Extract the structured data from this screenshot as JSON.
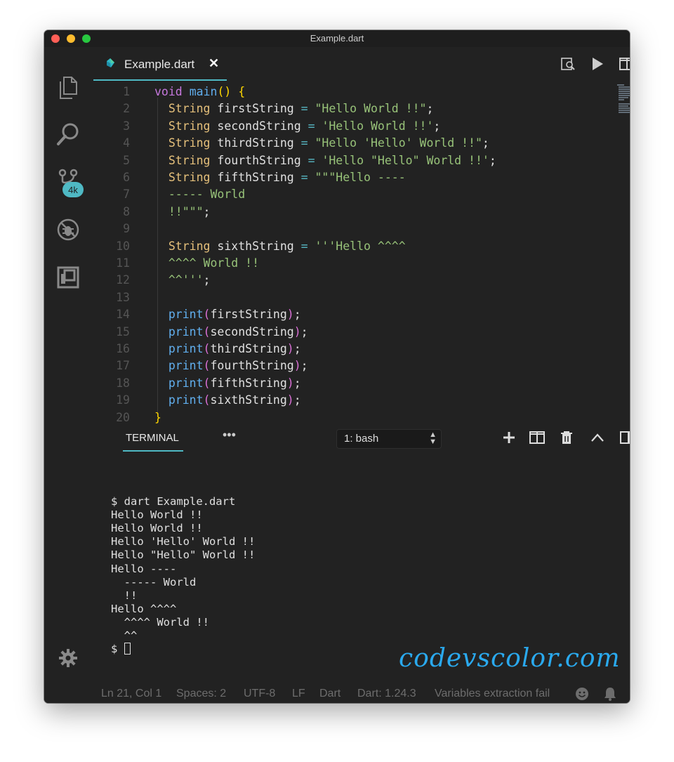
{
  "window": {
    "title": "Example.dart"
  },
  "activity_bar": {
    "scm_badge": "4k"
  },
  "tab": {
    "label": "Example.dart",
    "close_glyph": "✕"
  },
  "code": [
    {
      "n": "1",
      "tokens": [
        {
          "t": "void",
          "c": "kw"
        },
        {
          "t": " "
        },
        {
          "t": "main",
          "c": "fn"
        },
        {
          "t": "()",
          "c": "pa1"
        },
        {
          "t": " "
        },
        {
          "t": "{",
          "c": "pa1"
        }
      ]
    },
    {
      "n": "2",
      "tokens": [
        {
          "t": "  "
        },
        {
          "t": "String",
          "c": "ty"
        },
        {
          "t": " firstString "
        },
        {
          "t": "=",
          "c": "op"
        },
        {
          "t": " "
        },
        {
          "t": "\"Hello World !!\"",
          "c": "str"
        },
        {
          "t": ";"
        }
      ]
    },
    {
      "n": "3",
      "tokens": [
        {
          "t": "  "
        },
        {
          "t": "String",
          "c": "ty"
        },
        {
          "t": " secondString "
        },
        {
          "t": "=",
          "c": "op"
        },
        {
          "t": " "
        },
        {
          "t": "'Hello World !!'",
          "c": "str"
        },
        {
          "t": ";"
        }
      ]
    },
    {
      "n": "4",
      "tokens": [
        {
          "t": "  "
        },
        {
          "t": "String",
          "c": "ty"
        },
        {
          "t": " thirdString "
        },
        {
          "t": "=",
          "c": "op"
        },
        {
          "t": " "
        },
        {
          "t": "\"Hello 'Hello' World !!\"",
          "c": "str"
        },
        {
          "t": ";"
        }
      ]
    },
    {
      "n": "5",
      "tokens": [
        {
          "t": "  "
        },
        {
          "t": "String",
          "c": "ty"
        },
        {
          "t": " fourthString "
        },
        {
          "t": "=",
          "c": "op"
        },
        {
          "t": " "
        },
        {
          "t": "'Hello \"Hello\" World !!'",
          "c": "str"
        },
        {
          "t": ";"
        }
      ]
    },
    {
      "n": "6",
      "tokens": [
        {
          "t": "  "
        },
        {
          "t": "String",
          "c": "ty"
        },
        {
          "t": " fifthString "
        },
        {
          "t": "=",
          "c": "op"
        },
        {
          "t": " "
        },
        {
          "t": "\"\"\"Hello ----",
          "c": "str"
        }
      ]
    },
    {
      "n": "7",
      "tokens": [
        {
          "t": "  "
        },
        {
          "t": "----- World",
          "c": "str"
        }
      ]
    },
    {
      "n": "8",
      "tokens": [
        {
          "t": "  "
        },
        {
          "t": "!!\"\"\"",
          "c": "str"
        },
        {
          "t": ";"
        }
      ]
    },
    {
      "n": "9",
      "tokens": []
    },
    {
      "n": "10",
      "tokens": [
        {
          "t": "  "
        },
        {
          "t": "String",
          "c": "ty"
        },
        {
          "t": " sixthString "
        },
        {
          "t": "=",
          "c": "op"
        },
        {
          "t": " "
        },
        {
          "t": "'''Hello ^^^^",
          "c": "str"
        }
      ]
    },
    {
      "n": "11",
      "tokens": [
        {
          "t": "  "
        },
        {
          "t": "^^^^ World !!",
          "c": "str"
        }
      ]
    },
    {
      "n": "12",
      "tokens": [
        {
          "t": "  "
        },
        {
          "t": "^^'''",
          "c": "str"
        },
        {
          "t": ";"
        }
      ]
    },
    {
      "n": "13",
      "tokens": []
    },
    {
      "n": "14",
      "tokens": [
        {
          "t": "  "
        },
        {
          "t": "print",
          "c": "fn"
        },
        {
          "t": "(",
          "c": "pa2"
        },
        {
          "t": "firstString"
        },
        {
          "t": ")",
          "c": "pa2"
        },
        {
          "t": ";"
        }
      ]
    },
    {
      "n": "15",
      "tokens": [
        {
          "t": "  "
        },
        {
          "t": "print",
          "c": "fn"
        },
        {
          "t": "(",
          "c": "pa2"
        },
        {
          "t": "secondString"
        },
        {
          "t": ")",
          "c": "pa2"
        },
        {
          "t": ";"
        }
      ]
    },
    {
      "n": "16",
      "tokens": [
        {
          "t": "  "
        },
        {
          "t": "print",
          "c": "fn"
        },
        {
          "t": "(",
          "c": "pa2"
        },
        {
          "t": "thirdString"
        },
        {
          "t": ")",
          "c": "pa2"
        },
        {
          "t": ";"
        }
      ]
    },
    {
      "n": "17",
      "tokens": [
        {
          "t": "  "
        },
        {
          "t": "print",
          "c": "fn"
        },
        {
          "t": "(",
          "c": "pa2"
        },
        {
          "t": "fourthString"
        },
        {
          "t": ")",
          "c": "pa2"
        },
        {
          "t": ";"
        }
      ]
    },
    {
      "n": "18",
      "tokens": [
        {
          "t": "  "
        },
        {
          "t": "print",
          "c": "fn"
        },
        {
          "t": "(",
          "c": "pa2"
        },
        {
          "t": "fifthString"
        },
        {
          "t": ")",
          "c": "pa2"
        },
        {
          "t": ";"
        }
      ]
    },
    {
      "n": "19",
      "tokens": [
        {
          "t": "  "
        },
        {
          "t": "print",
          "c": "fn"
        },
        {
          "t": "(",
          "c": "pa2"
        },
        {
          "t": "sixthString"
        },
        {
          "t": ")",
          "c": "pa2"
        },
        {
          "t": ";"
        }
      ]
    },
    {
      "n": "20",
      "tokens": [
        {
          "t": "}",
          "c": "pa1"
        }
      ]
    }
  ],
  "panel": {
    "tab_label": "TERMINAL",
    "more_glyph": "•••",
    "shell_select": "1: bash",
    "terminal_lines": [
      "$ dart Example.dart",
      "Hello World !!",
      "Hello World !!",
      "Hello 'Hello' World !!",
      "Hello \"Hello\" World !!",
      "Hello ----",
      "  ----- World",
      "  !!",
      "Hello ^^^^",
      "  ^^^^ World !!",
      "  ^^"
    ],
    "prompt": "$ "
  },
  "watermark": "codevscolor.com",
  "statusbar": {
    "position": "Ln 21, Col 1",
    "spaces": "Spaces: 2",
    "encoding": "UTF-8",
    "eol": "LF",
    "language": "Dart",
    "sdk": "Dart: 1.24.3",
    "message": "Variables extraction fail"
  },
  "colors": {
    "accent": "#4fb9c4",
    "keyword": "#c678dd",
    "function": "#61afef",
    "type": "#e5c07b",
    "string": "#98c379",
    "operator": "#56b6c2",
    "watermark": "#2aa9ee"
  },
  "icons": [
    "files-icon",
    "search-icon",
    "source-control-icon",
    "debug-icon",
    "extensions-icon",
    "settings-gear-icon",
    "dart-file-icon",
    "open-changes-icon",
    "run-icon",
    "split-editor-icon",
    "more-actions-icon",
    "add-terminal-icon",
    "split-terminal-icon",
    "trash-icon",
    "chevron-up-icon",
    "maximize-panel-icon",
    "close-panel-icon",
    "smiley-icon",
    "bell-icon"
  ]
}
